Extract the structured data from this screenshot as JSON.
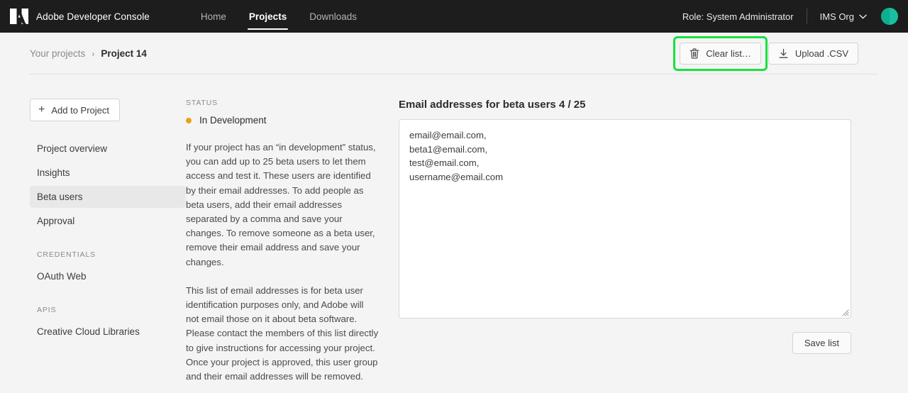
{
  "topnav": {
    "logo_icon": "adobe-logo-icon",
    "brand": "Adobe Developer Console",
    "tabs": [
      {
        "label": "Home",
        "active": false
      },
      {
        "label": "Projects",
        "active": true
      },
      {
        "label": "Downloads",
        "active": false
      }
    ],
    "role": "Role: System Administrator",
    "org": "IMS Org",
    "org_chevron_icon": "chevron-down-icon",
    "avatar_icon": "user-avatar",
    "avatar_color": "#17c1a0"
  },
  "subheader": {
    "breadcrumb": {
      "parent": "Your projects",
      "separator": "›",
      "current": "Project 14"
    },
    "actions": {
      "clear": {
        "label": "Clear list…",
        "icon": "trash-icon",
        "focused": true
      },
      "upload": {
        "label": "Upload .CSV",
        "icon": "upload-icon",
        "focused": false
      }
    },
    "focus_color": "#18e13f"
  },
  "sidebar": {
    "add_button": {
      "label": "Add to Project",
      "icon": "plus-icon"
    },
    "items": [
      {
        "label": "Project overview",
        "selected": false
      },
      {
        "label": "Insights",
        "selected": false
      },
      {
        "label": "Beta users",
        "selected": true
      },
      {
        "label": "Approval",
        "selected": false
      }
    ],
    "credentials_label": "CREDENTIALS",
    "credentials": [
      {
        "label": "OAuth Web",
        "selected": false
      }
    ],
    "apis_label": "APIS",
    "apis": [
      {
        "label": "Creative Cloud Libraries",
        "selected": false
      }
    ]
  },
  "status": {
    "caption": "STATUS",
    "value": "In Development",
    "dot_color": "#e8a117",
    "paragraphs": [
      "If your project has an “in development” status, you can add up to 25 beta users to let them access and test it. These users are identified by their email addresses. To add people as beta users, add their email addresses separated by a comma and save your changes. To remove someone as a beta user, remove their email address and save your changes.",
      "This list of email addresses is for beta user identification purposes only, and Adobe will not email those on it about beta software. Please contact the members of this list directly to give instructions for accessing your project. Once your project is approved, this user group and their email addresses will be removed."
    ]
  },
  "emails": {
    "title": "Email addresses for beta users 4 / 25",
    "count": 4,
    "max": 25,
    "placeholder": "",
    "value": "email@email.com,\nbeta1@email.com,\ntest@email.com,\nusername@email.com",
    "list": [
      "email@email.com,",
      "beta1@email.com,",
      "test@email.com,",
      "username@email.com"
    ],
    "resize_handle_icon": "resize-grip-icon",
    "save_label": "Save list"
  }
}
